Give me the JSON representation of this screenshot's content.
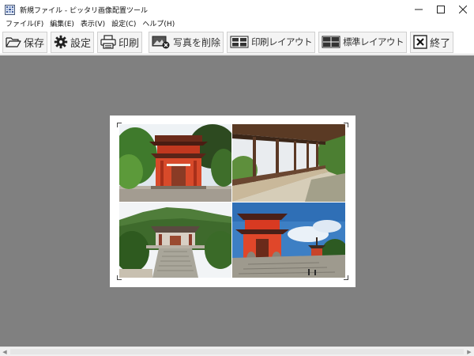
{
  "window": {
    "title": "新規ファイル - ピッタリ画像配置ツール",
    "icons": {
      "app": "app-grid-icon",
      "minimize": "minimize-icon",
      "maximize": "maximize-icon",
      "close": "close-icon"
    }
  },
  "menu": [
    {
      "label": "ファイル(F)"
    },
    {
      "label": "編集(E)"
    },
    {
      "label": "表示(V)"
    },
    {
      "label": "設定(C)"
    },
    {
      "label": "ヘルプ(H)"
    }
  ],
  "toolbar": {
    "save": {
      "label": "保存",
      "icon": "folder-open-icon"
    },
    "settings": {
      "label": "設定",
      "icon": "gear-icon"
    },
    "print": {
      "label": "印刷",
      "icon": "printer-icon"
    },
    "delete_photo": {
      "label": "写真を削除",
      "icon": "delete-photo-icon"
    },
    "print_layout": {
      "label": "印刷レイアウト",
      "icon": "layout-icon"
    },
    "standard_layout": {
      "label": "標準レイアウト",
      "icon": "layout-icon"
    },
    "exit": {
      "label": "終了",
      "icon": "close-box-icon"
    }
  },
  "canvas": {
    "background_color": "#808080",
    "photos": [
      {
        "subject": "red-shrine-gate-photo"
      },
      {
        "subject": "temple-corridor-photo"
      },
      {
        "subject": "mountain-temple-photo"
      },
      {
        "subject": "red-pagoda-photo"
      }
    ]
  }
}
